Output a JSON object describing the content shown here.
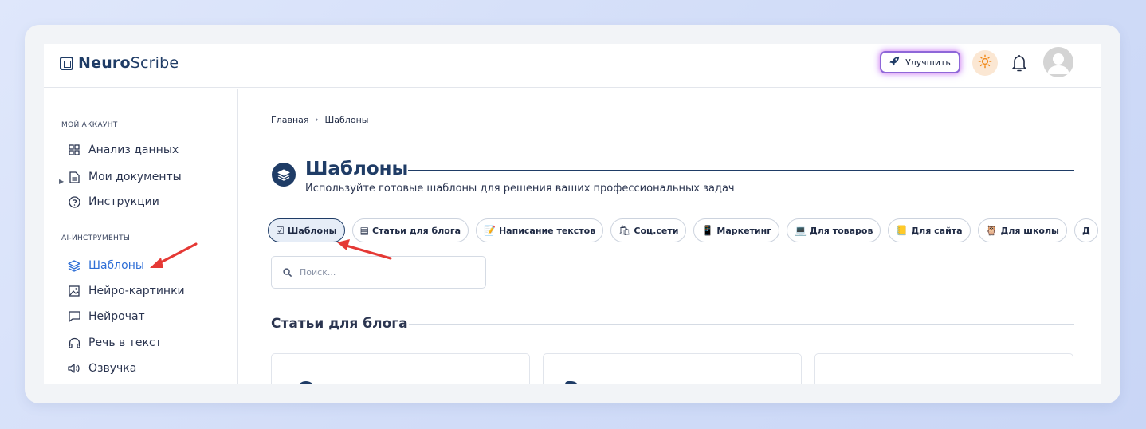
{
  "app": {
    "logo_bold": "Neuro",
    "logo_regular": "Scribe"
  },
  "topbar": {
    "upgrade_label": "Улучшить",
    "icons": [
      "rocket-icon",
      "sun-icon",
      "bell-icon",
      "avatar"
    ]
  },
  "sidebar": {
    "section_account": "МОЙ АККАУНТ",
    "account_items": [
      {
        "label": "Анализ данных",
        "icon": "grid-icon"
      },
      {
        "label": "Мои документы",
        "icon": "document-icon"
      },
      {
        "label": "Инструкции",
        "icon": "help-icon"
      }
    ],
    "section_ai": "AI-ИНСТРУМЕНТЫ",
    "ai_items": [
      {
        "label": "Шаблоны",
        "icon": "layers-icon",
        "active": true
      },
      {
        "label": "Нейро-картинки",
        "icon": "image-icon"
      },
      {
        "label": "Нейрочат",
        "icon": "chat-icon"
      },
      {
        "label": "Речь в текст",
        "icon": "headphones-icon"
      },
      {
        "label": "Озвучка",
        "icon": "speaker-icon"
      }
    ]
  },
  "main": {
    "breadcrumb": [
      "Главная",
      "Шаблоны"
    ],
    "breadcrumb_sep": "›",
    "title": "Шаблоны",
    "subtitle": "Используйте готовые шаблоны для решения ваших профессиональных задач",
    "tabs": [
      {
        "label": "Шаблоны",
        "emoji": "☑",
        "active": true
      },
      {
        "label": "Статьи для блога",
        "emoji": "▤"
      },
      {
        "label": "Написание текстов",
        "emoji": "📝"
      },
      {
        "label": "Соц.сети",
        "emoji": "🛍"
      },
      {
        "label": "Маркетинг",
        "emoji": "📱"
      },
      {
        "label": "Для товаров",
        "emoji": "💻"
      },
      {
        "label": "Для сайта",
        "emoji": "📒"
      },
      {
        "label": "Для школы",
        "emoji": "🦉"
      },
      {
        "label": "Д",
        "emoji": ""
      }
    ],
    "search_placeholder": "Поиск...",
    "section_heading": "Статьи для блога"
  },
  "colors": {
    "primary": "#1f3c66",
    "active_nav": "#2f6fd6",
    "annotation_arrow": "#e53935",
    "theme_bg": "#fbe7d3",
    "theme_icon": "#f08a1c"
  }
}
